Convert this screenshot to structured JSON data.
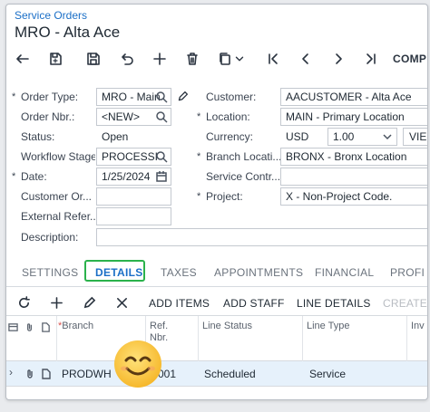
{
  "header": {
    "breadcrumb": "Service Orders",
    "title": "MRO - Alta Ace"
  },
  "toolbar": {
    "buttons": [
      "back-icon",
      "save-close-icon",
      "save-icon",
      "undo-icon",
      "add-icon",
      "delete-icon",
      "copy-icon",
      "first-icon",
      "prev-icon",
      "next-icon",
      "last-icon"
    ],
    "overflow_label": "COMP"
  },
  "form": {
    "order_type": {
      "label": "Order Type:",
      "value": "MRO - Main"
    },
    "order_nbr": {
      "label": "Order Nbr.:",
      "value": "<NEW>"
    },
    "status": {
      "label": "Status:",
      "value": "Open"
    },
    "workflow_stage": {
      "label": "Workflow Stage:",
      "value": "PROCESSI"
    },
    "date": {
      "label": "Date:",
      "value": "1/25/2024"
    },
    "customer_order": {
      "label": "Customer Or...",
      "value": ""
    },
    "external_ref": {
      "label": "External Refer...",
      "value": ""
    },
    "description": {
      "label": "Description:",
      "value": ""
    },
    "customer": {
      "label": "Customer:",
      "value": "AACUSTOMER - Alta Ace"
    },
    "location": {
      "label": "Location:",
      "value": "MAIN - Primary Location"
    },
    "currency": {
      "label": "Currency:",
      "code": "USD",
      "rate": "1.00",
      "view_label": "VIE"
    },
    "branch_location": {
      "label": "Branch Locati...",
      "value": "BRONX - Bronx Location"
    },
    "service_contract": {
      "label": "Service Contr...",
      "value": ""
    },
    "project": {
      "label": "Project:",
      "value": "X - Non-Project Code."
    }
  },
  "tabs": [
    "SETTINGS",
    "DETAILS",
    "TAXES",
    "APPOINTMENTS",
    "FINANCIAL",
    "PROFI"
  ],
  "active_tab": "DETAILS",
  "grid_toolbar": {
    "add_items": "ADD ITEMS",
    "add_staff": "ADD STAFF",
    "line_details": "LINE DETAILS",
    "create": "CREATE"
  },
  "grid": {
    "columns": {
      "branch": "Branch",
      "ref_nbr_1": "Ref.",
      "ref_nbr_2": "Nbr.",
      "line_status": "Line Status",
      "line_type": "Line Type",
      "inv": "Inv"
    },
    "rows": [
      {
        "branch": "PRODWH",
        "ref_nbr": "001",
        "line_status": "Scheduled",
        "line_type": "Service"
      }
    ]
  },
  "colors": {
    "accent": "#1b6fc7",
    "tab_highlight": "#2bb24c",
    "row_selected": "#e6f1fb"
  }
}
